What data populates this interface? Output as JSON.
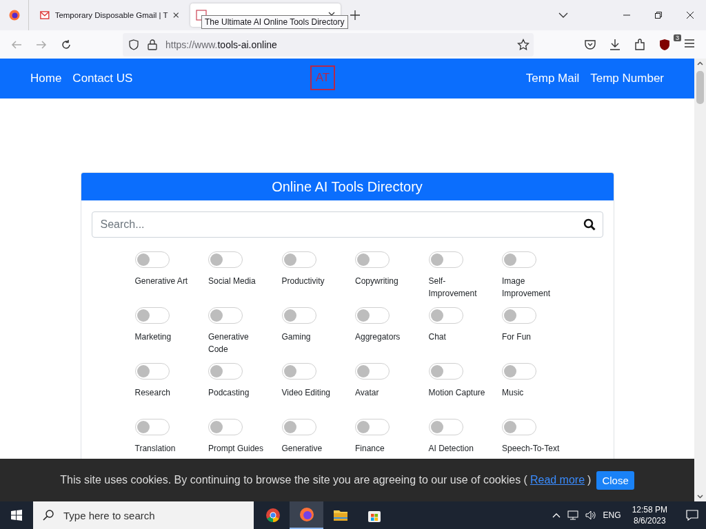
{
  "browser": {
    "tabs": [
      {
        "title": "Temporary Disposable Gmail | T",
        "selected": false
      },
      {
        "selected": true
      }
    ],
    "tooltip": "The Ultimate AI Online Tools Directory",
    "url_prefix": "https://www.",
    "url_domain": "tools-ai.online",
    "extension_badge": "3"
  },
  "site_nav": {
    "left": [
      "Home",
      "Contact US"
    ],
    "logo": "AT",
    "right": [
      "Temp Mail",
      "Temp Number"
    ]
  },
  "directory": {
    "title": "Online AI Tools Directory",
    "search": {
      "placeholder": "Search..."
    },
    "categories": [
      {
        "label": "Generative Art",
        "on": false
      },
      {
        "label": "Social Media",
        "on": false
      },
      {
        "label": "Productivity",
        "on": false
      },
      {
        "label": "Copywriting",
        "on": false
      },
      {
        "label": "Self-Improvement",
        "on": false
      },
      {
        "label": "Image Improvement",
        "on": false
      },
      {
        "label": "Marketing",
        "on": false
      },
      {
        "label": "Generative Code",
        "on": false
      },
      {
        "label": "Gaming",
        "on": false
      },
      {
        "label": "Aggregators",
        "on": false
      },
      {
        "label": "Chat",
        "on": false
      },
      {
        "label": "For Fun",
        "on": false
      },
      {
        "label": "Research",
        "on": false
      },
      {
        "label": "Podcasting",
        "on": false
      },
      {
        "label": "Video Editing",
        "on": false
      },
      {
        "label": "Avatar",
        "on": false
      },
      {
        "label": "Motion Capture",
        "on": false
      },
      {
        "label": "Music",
        "on": false
      },
      {
        "label": "Translation",
        "on": false
      },
      {
        "label": "Prompt Guides",
        "on": false
      },
      {
        "label": "Generative",
        "on": false
      },
      {
        "label": "Finance",
        "on": false
      },
      {
        "label": "AI Detection",
        "on": false
      },
      {
        "label": "Speech-To-Text",
        "on": false
      }
    ]
  },
  "cookie_notice": {
    "text": "This site uses cookies. By continuing to browse the site you are agreeing to our use of cookies (",
    "link": "Read more",
    "after": ")",
    "button": "Close"
  },
  "taskbar": {
    "search_placeholder": "Type here to search",
    "apps": [
      {
        "kind": "chrome",
        "selected": false
      },
      {
        "kind": "firefox",
        "selected": true
      },
      {
        "kind": "folder",
        "selected": false
      },
      {
        "kind": "store",
        "selected": false
      }
    ],
    "language": "ENG",
    "time": "12:58 PM",
    "date": "8/6/2023"
  }
}
